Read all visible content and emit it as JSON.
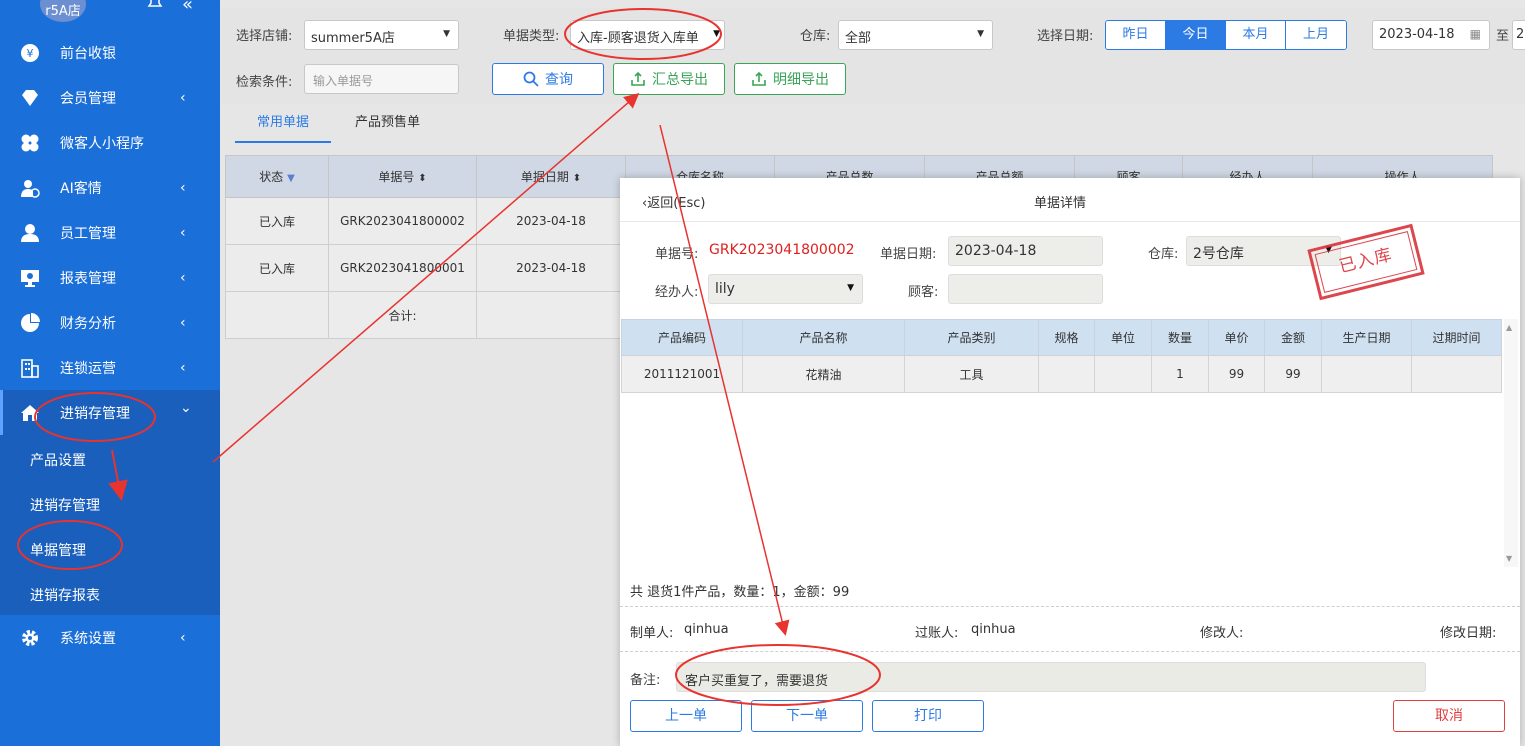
{
  "sidebar": {
    "store_badge": "r5A店",
    "menu": [
      {
        "label": "前台收银",
        "icon": "yen-icon",
        "arrow": ""
      },
      {
        "label": "会员管理",
        "icon": "diamond-icon",
        "arrow": "‹"
      },
      {
        "label": "微客人小程序",
        "icon": "clover-icon",
        "arrow": ""
      },
      {
        "label": "AI客情",
        "icon": "user-plus-icon",
        "arrow": "‹"
      },
      {
        "label": "员工管理",
        "icon": "person-icon",
        "arrow": "‹"
      },
      {
        "label": "报表管理",
        "icon": "monitor-icon",
        "arrow": "‹"
      },
      {
        "label": "财务分析",
        "icon": "pie-icon",
        "arrow": "‹"
      },
      {
        "label": "连锁运营",
        "icon": "building-icon",
        "arrow": "‹"
      },
      {
        "label": "进销存管理",
        "icon": "home-icon",
        "arrow": "⌄"
      }
    ],
    "submenu": [
      "产品设置",
      "进销存管理",
      "单据管理",
      "进销存报表"
    ],
    "bottom_menu": {
      "label": "系统设置",
      "arrow": "‹"
    }
  },
  "filters": {
    "store_label": "选择店铺:",
    "store_value": "summer5A店",
    "doc_type_label": "单据类型:",
    "doc_type_value": "入库-顾客退货入库单",
    "warehouse_label": "仓库:",
    "warehouse_value": "全部",
    "date_label": "选择日期:",
    "date_tabs": [
      "昨日",
      "今日",
      "本月",
      "上月"
    ],
    "active_date_tab": 1,
    "start_date": "2023-04-18",
    "to_label": "至",
    "end_date_partial": "2",
    "search_label": "检索条件:",
    "search_placeholder": "输入单据号",
    "query_button": "查询",
    "summary_export_button": "汇总导出",
    "detail_export_button": "明细导出"
  },
  "tabs": [
    "常用单据",
    "产品预售单"
  ],
  "table": {
    "headers": [
      "状态",
      "单据号",
      "单据日期",
      "仓库名称",
      "产品总数",
      "产品总额",
      "顾客",
      "经办人",
      "操作人"
    ],
    "rows": [
      [
        "已入库",
        "GRK2023041800002",
        "2023-04-18"
      ],
      [
        "已入库",
        "GRK2023041800001",
        "2023-04-18"
      ]
    ],
    "total_label": "合计:"
  },
  "modal": {
    "back": "返回(Esc)",
    "title": "单据详情",
    "doc_no_label": "单据号:",
    "doc_no": "GRK2023041800002",
    "doc_date_label": "单据日期:",
    "doc_date": "2023-04-18",
    "warehouse_label": "仓库:",
    "warehouse": "2号仓库",
    "handler_label": "经办人:",
    "handler": "lily",
    "customer_label": "顾客:",
    "customer": "",
    "stamp": "已入库",
    "product_headers": [
      "产品编码",
      "产品名称",
      "产品类别",
      "规格",
      "单位",
      "数量",
      "单价",
      "金额",
      "生产日期",
      "过期时间"
    ],
    "product_rows": [
      [
        "2011121001",
        "花精油",
        "工具",
        "",
        "",
        "1",
        "99",
        "99",
        "",
        ""
      ]
    ],
    "summary": "共 退货1件产品，数量：1，金额：99",
    "creator_label": "制单人:",
    "creator": "qinhua",
    "poster_label": "过账人:",
    "poster": "qinhua",
    "modifier_label": "修改人:",
    "modifier": "",
    "modify_date_label": "修改日期:",
    "remark_label": "备注:",
    "remark": "客户买重复了，需要退货",
    "prev_button": "上一单",
    "next_button": "下一单",
    "print_button": "打印",
    "cancel_button": "取消"
  },
  "colors": {
    "sidebar": "#1b6fd8",
    "accent": "#2c7be5",
    "export_green": "#3aa457",
    "annotation_red": "#e8332f"
  }
}
